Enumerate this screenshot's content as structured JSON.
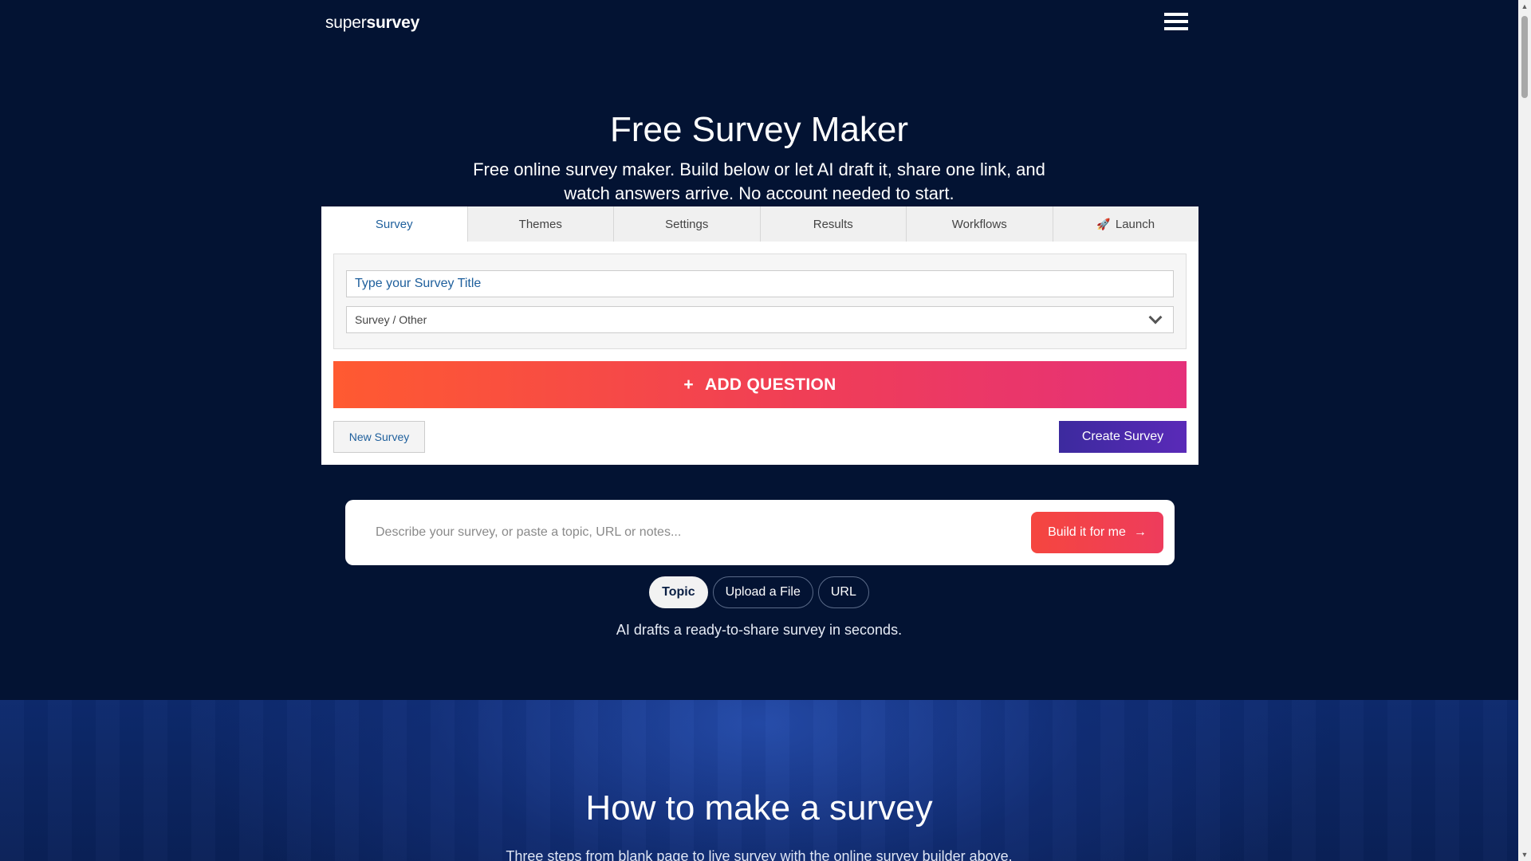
{
  "nav": {
    "logo_thin": "super",
    "logo_bold": "survey",
    "menu_icon": "hamburger-menu-icon"
  },
  "hero": {
    "title": "Free Survey Maker",
    "subtitle": "Free online survey maker. Build below or let AI draft it, share one link, and watch answers arrive. No account needed to start."
  },
  "builder": {
    "tabs": [
      {
        "label": "Survey",
        "active": true
      },
      {
        "label": "Themes"
      },
      {
        "label": "Settings"
      },
      {
        "label": "Results"
      },
      {
        "label": "Workflows"
      },
      {
        "label": "Launch",
        "icon": "🚀"
      }
    ],
    "title_placeholder": "Type your Survey Title",
    "category_value": "Survey / Other",
    "add_question_label": "ADD QUESTION",
    "add_question_icon": "+",
    "new_survey_label": "New Survey",
    "create_survey_label": "Create Survey"
  },
  "ai": {
    "placeholder": "Describe your survey, or paste a topic, URL or notes...",
    "build_label": "Build it for me",
    "build_arrow": "→",
    "modes": [
      {
        "label": "Topic",
        "active": true
      },
      {
        "label": "Upload a File"
      },
      {
        "label": "URL"
      }
    ],
    "note": "AI drafts a ready-to-share survey in seconds."
  },
  "howto": {
    "title": "How to make a survey",
    "subtitle": "Three steps from blank page to live survey with the online survey builder above."
  },
  "colors": {
    "background": "#031333",
    "accent_orange": "#ff5a31",
    "accent_pink": "#e5307a",
    "accent_purple": "#5a2ab8",
    "link_blue": "#1e5f9c"
  }
}
